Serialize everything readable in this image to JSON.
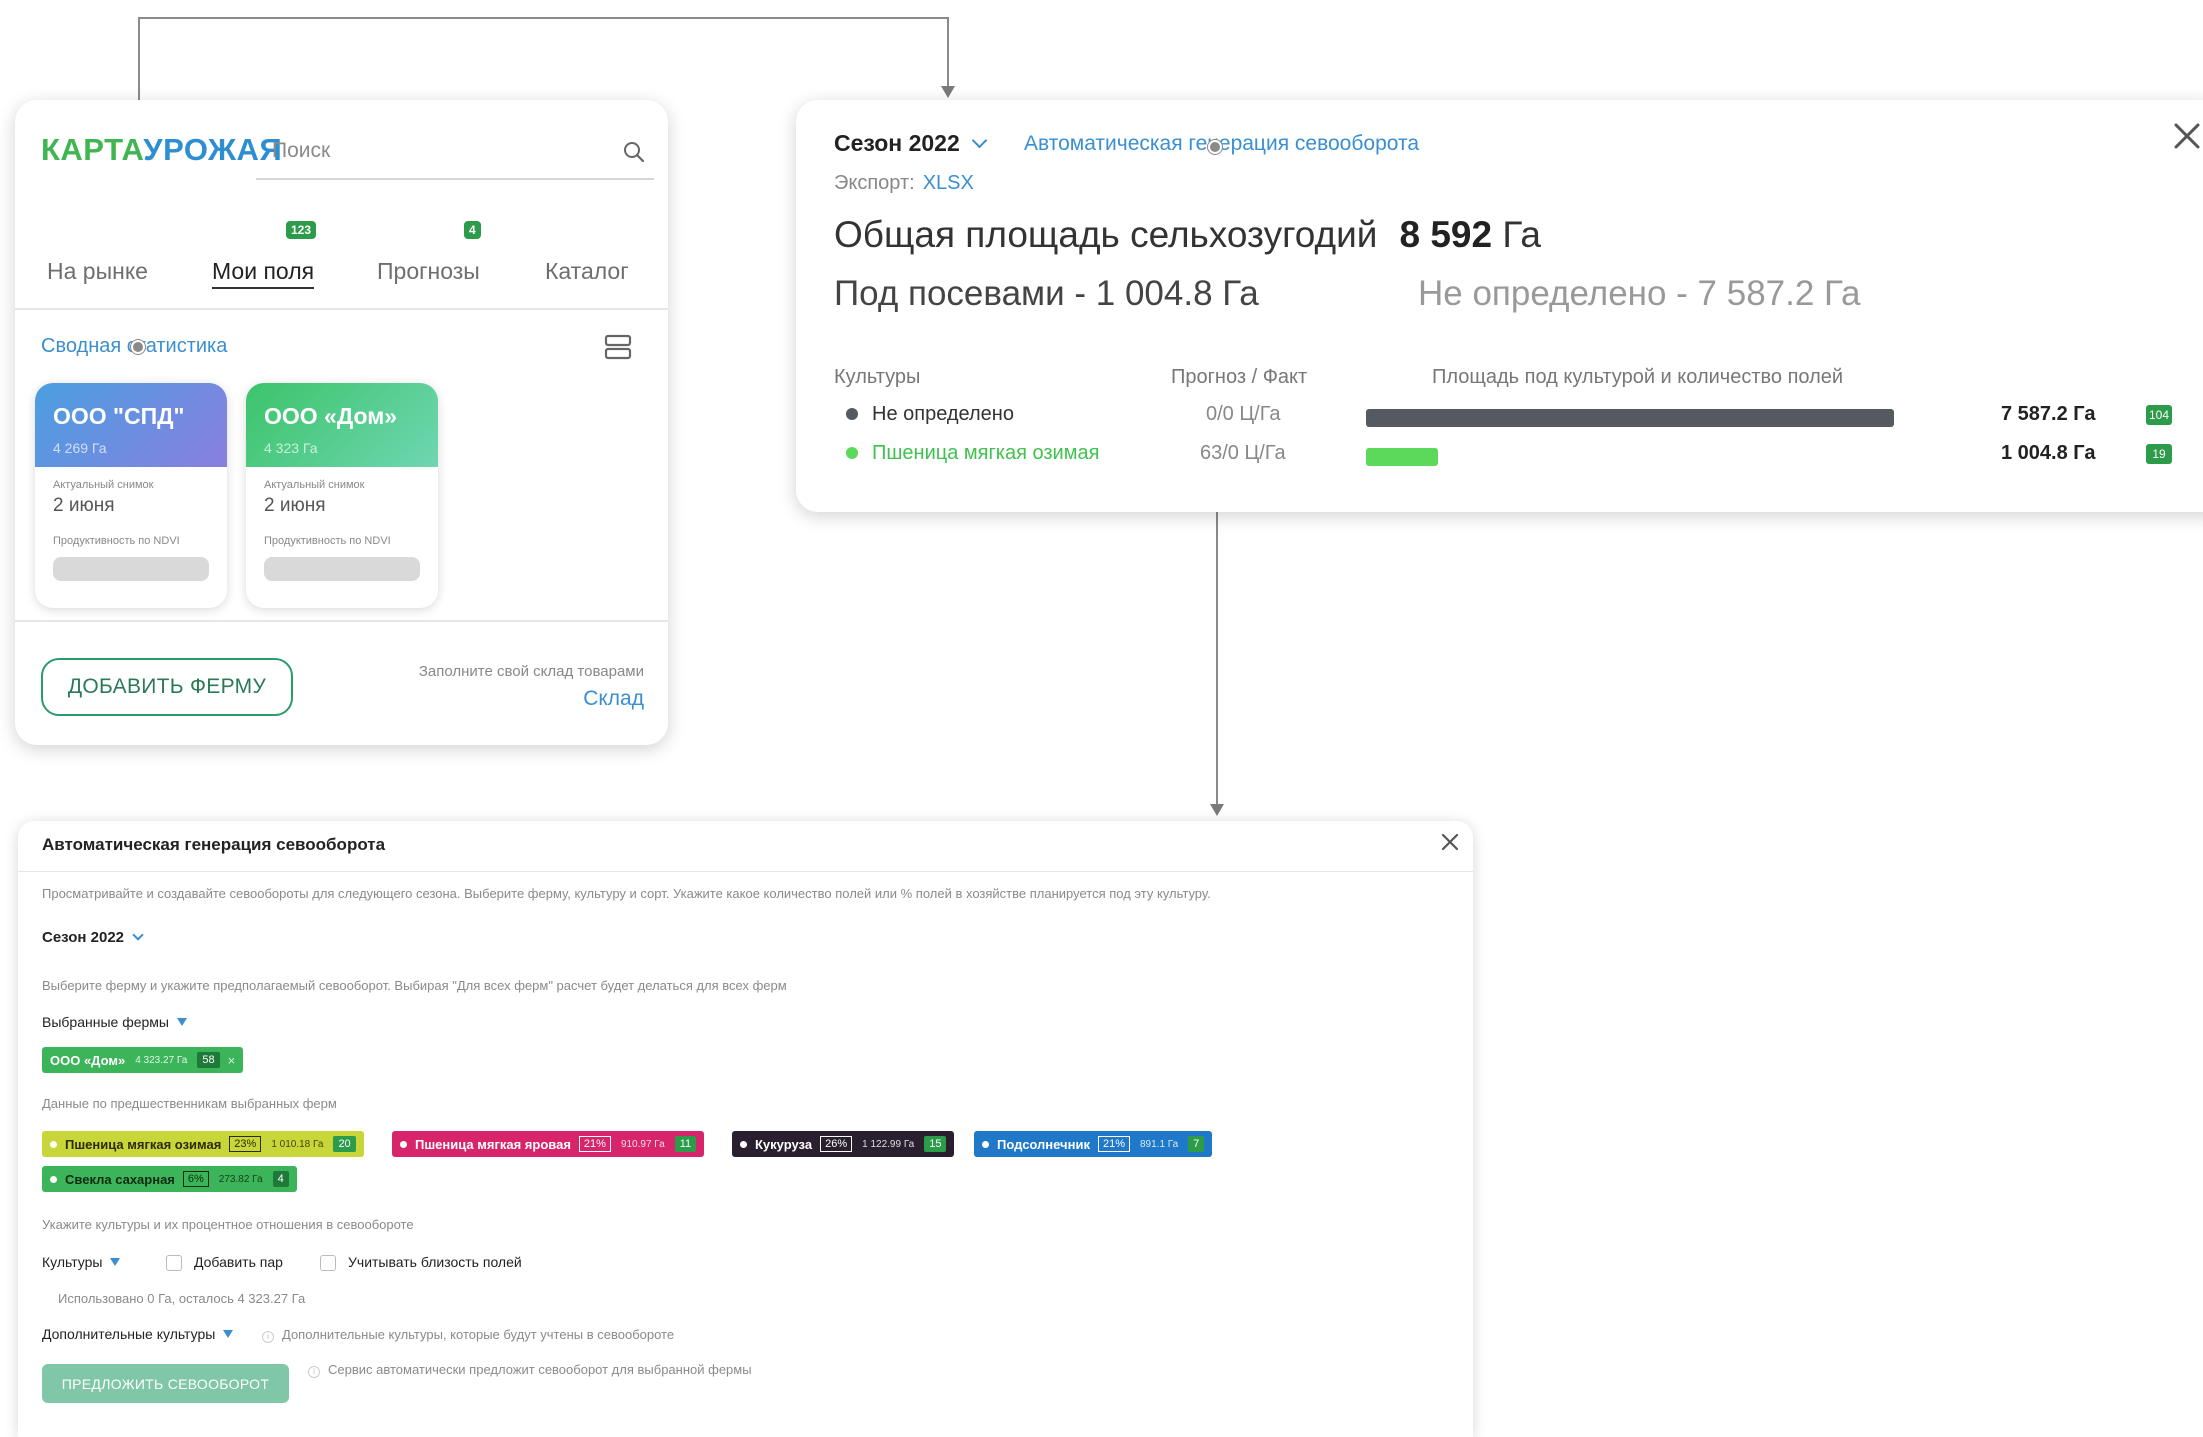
{
  "app": {
    "logo_part1": "КАРТА",
    "logo_part2": "УРОЖАЯ",
    "search_placeholder": "Поиск",
    "tabs": [
      {
        "label": "На рынке",
        "badge": null
      },
      {
        "label": "Мои поля",
        "badge": "123"
      },
      {
        "label": "Прогнозы",
        "badge": "4"
      },
      {
        "label": "Каталог",
        "badge": null
      }
    ],
    "stats_link": "Сводная статистика",
    "farms": [
      {
        "name": "ООО \"СПД\"",
        "area": "4 269 Га",
        "snapshot_label": "Актуальный снимок",
        "snapshot_date": "2 июня",
        "ndvi_label": "Продуктивность по NDVI",
        "color_from": "#4a9fe0",
        "color_to": "#8a7fe0"
      },
      {
        "name": "ООО «Дом»",
        "area": "4 323 Га",
        "snapshot_label": "Актуальный снимок",
        "snapshot_date": "2 июня",
        "ndvi_label": "Продуктивность по NDVI",
        "color_from": "#3cc46a",
        "color_to": "#6fd6b2"
      }
    ],
    "add_farm_button": "ДОБАВИТЬ ФЕРМУ",
    "fill_hint": "Заполните свой склад товарами",
    "warehouse_link": "Склад"
  },
  "season_panel": {
    "season": "Сезон 2022",
    "autogen_link": "Автоматическая генерация севооборота",
    "export_label": "Экспорт:",
    "export_format": "XLSX",
    "total_label": "Общая площадь сельхозугодий",
    "total_value": "8 592",
    "total_unit": "Га",
    "sown_text": "Под посевами - 1 004.8 Га",
    "undefined_text": "Не определено - 7 587.2 Га",
    "columns": [
      "Культуры",
      "Прогноз / Факт",
      "Площадь под культурой и количество полей"
    ],
    "crops": [
      {
        "name": "Не определено",
        "forecast": "0/0 Ц/Га",
        "area": "7 587.2 Га",
        "fields": "104",
        "color": "#555a60",
        "share": 0.883
      },
      {
        "name": "Пшеница мягкая озимая",
        "forecast": "63/0 Ц/Га",
        "area": "1 004.8 Га",
        "fields": "19",
        "color": "#5cd85a",
        "share": 0.117
      }
    ]
  },
  "modal": {
    "title": "Автоматическая генерация севооборота",
    "description": "Просматривайте и создавайте севообороты для следующего сезона. Выберите ферму, культуру и сорт. Укажите какое количество полей или % полей в хозяйстве планируется под эту культуру.",
    "season": "Сезон 2022",
    "farm_hint": "Выберите ферму и укажите предполагаемый севооборот. Выбирая \"Для всех ферм\" расчет будет делаться для всех ферм",
    "selected_farms_label": "Выбранные фермы",
    "selected_farm": {
      "name": "ООО «Дом»",
      "area": "4 323.27 Га",
      "fields": "58",
      "remove": "×"
    },
    "predecessors_label": "Данные по предшественникам выбранных ферм",
    "predecessors": [
      {
        "name": "Пшеница мягкая озимая",
        "pct": "23%",
        "area": "1 010.18 Га",
        "fields": "20",
        "bg": "#c9d63a",
        "fg": "#2b2b00",
        "dot": "#ffffff"
      },
      {
        "name": "Пшеница мягкая яровая",
        "pct": "21%",
        "area": "910.97 Га",
        "fields": "11",
        "bg": "#d8246a",
        "fg": "#ffffff",
        "dot": "#ffffff"
      },
      {
        "name": "Кукуруза",
        "pct": "26%",
        "area": "1 122.99 Га",
        "fields": "15",
        "bg": "#2a1f2e",
        "fg": "#ffffff",
        "dot": "#ffffff"
      },
      {
        "name": "Подсолнечник",
        "pct": "21%",
        "area": "891.1 Га",
        "fields": "7",
        "bg": "#1f78c8",
        "fg": "#ffffff",
        "dot": "#ffffff"
      },
      {
        "name": "Свекла сахарная",
        "pct": "6%",
        "area": "273.82 Га",
        "fields": "4",
        "bg": "#3cb55a",
        "fg": "#0f2a12",
        "dot": "#ffffff"
      }
    ],
    "crops_hint": "Укажите культуры и их процентное отношения в севообороте",
    "crops_label": "Культуры",
    "add_fallow": "Добавить пар",
    "consider_proximity": "Учитывать близость полей",
    "used_text": "Использовано 0 Га, осталось 4 323.27 Га",
    "additional_label": "Дополнительные культуры",
    "additional_hint": "Дополнительные культуры, которые будут учтены в севообороте",
    "suggest_button": "ПРЕДЛОЖИТЬ СЕВООБОРОТ",
    "suggest_hint": "Сервис автоматически предложит севооборот для выбранной фермы"
  }
}
